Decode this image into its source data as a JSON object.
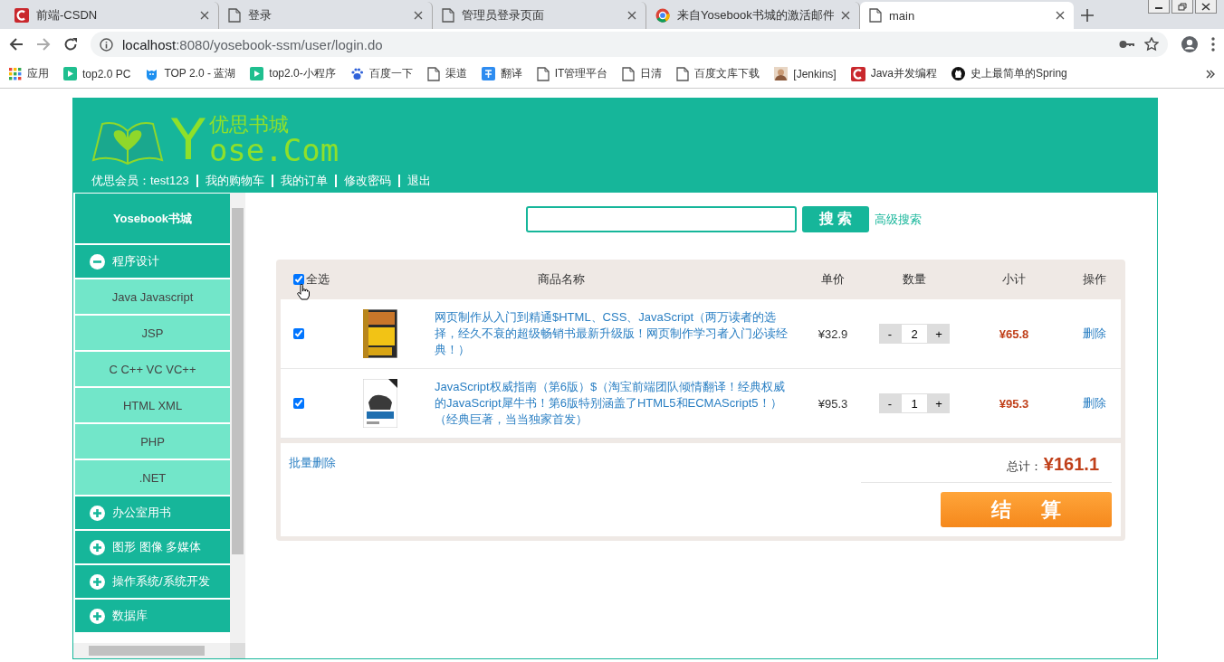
{
  "browser": {
    "tabs": [
      {
        "title": "前端-CSDN",
        "selected": false
      },
      {
        "title": "登录",
        "selected": false
      },
      {
        "title": "管理员登录页面",
        "selected": false
      },
      {
        "title": "来自Yosebook书城的激活邮件",
        "selected": false
      },
      {
        "title": "main",
        "selected": true
      }
    ],
    "url_host": "localhost",
    "url_rest": ":8080/yosebook-ssm/user/login.do",
    "bookmarks": [
      {
        "label": "应用"
      },
      {
        "label": "top2.0 PC"
      },
      {
        "label": "TOP 2.0 - 蓝湖"
      },
      {
        "label": "top2.0-小程序"
      },
      {
        "label": "百度一下"
      },
      {
        "label": "渠道"
      },
      {
        "label": "翻译"
      },
      {
        "label": "IT管理平台"
      },
      {
        "label": "日清"
      },
      {
        "label": "百度文库下载"
      },
      {
        "label": "[Jenkins]"
      },
      {
        "label": "Java并发编程"
      },
      {
        "label": "史上最简单的Spring"
      }
    ]
  },
  "site": {
    "logo": {
      "title": "优思书城",
      "mark": "Y",
      "wordmark": "ose.Com"
    },
    "nav": [
      {
        "label": "优思会员：test123"
      },
      {
        "label": "我的购物车"
      },
      {
        "label": "我的订单"
      },
      {
        "label": "修改密码"
      },
      {
        "label": "退出"
      }
    ]
  },
  "sidebar": {
    "title": "Yosebook书城",
    "categories": [
      {
        "label": "程序设计",
        "expanded": true,
        "children": [
          {
            "label": "Java Javascript"
          },
          {
            "label": "JSP"
          },
          {
            "label": "C C++ VC VC++"
          },
          {
            "label": "HTML XML"
          },
          {
            "label": "PHP"
          },
          {
            "label": ".NET"
          }
        ]
      },
      {
        "label": "办公室用书",
        "expanded": false
      },
      {
        "label": "图形 图像 多媒体",
        "expanded": false
      },
      {
        "label": "操作系统/系统开发",
        "expanded": false
      },
      {
        "label": "数据库",
        "expanded": false
      }
    ]
  },
  "search": {
    "button": "搜 索",
    "advanced": "高级搜索"
  },
  "cart": {
    "select_all": {
      "label": "全选",
      "checked": true
    },
    "columns": [
      "商品名称",
      "单价",
      "数量",
      "小计",
      "操作"
    ],
    "items": [
      {
        "checked": true,
        "title": "网页制作从入门到精通$HTML、CSS、JavaScript（两万读者的选择，经久不衰的超级畅销书最新升级版！网页制作学习者入门必读经典！）",
        "price": "¥32.9",
        "decrement": "-",
        "quantity": "2",
        "increment": "+",
        "subtotal": "¥65.8",
        "action": "删除"
      },
      {
        "checked": true,
        "title": "JavaScript权威指南（第6版）$（淘宝前端团队倾情翻译！经典权威的JavaScript犀牛书！第6版特别涵盖了HTML5和ECMAScript5！）（经典巨著，当当独家首发）",
        "price": "¥95.3",
        "decrement": "-",
        "quantity": "1",
        "increment": "+",
        "subtotal": "¥95.3",
        "action": "删除"
      }
    ],
    "batch_delete": "批量删除",
    "total_label": "总计：",
    "total": "¥161.1",
    "checkout": "结 算"
  }
}
